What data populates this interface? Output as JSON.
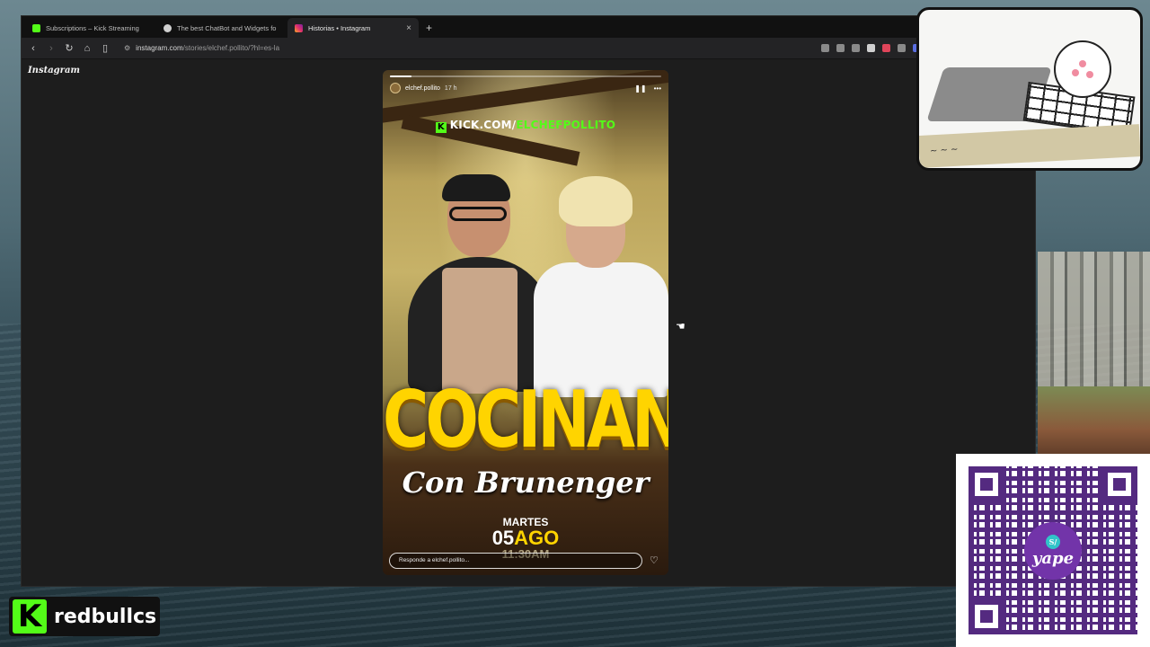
{
  "browser": {
    "tabs": [
      {
        "title": "Subscriptions – Kick Streaming",
        "favicon_color": "#53fc18",
        "active": false
      },
      {
        "title": "The best ChatBot and Widgets fo",
        "favicon_color": "#d0d0d0",
        "active": false
      },
      {
        "title": "Historias • Instagram",
        "favicon_color": "#e1306c",
        "active": true
      }
    ],
    "new_tab": "+",
    "tab_close": "×",
    "url_host": "instagram.com",
    "url_path": "/stories/elchef.pollito/?hl=es-la"
  },
  "instagram": {
    "logo": "Instagram",
    "story": {
      "username": "elchef.pollito",
      "time_ago": "17 h",
      "progress": 0.08,
      "kick_url_prefix": "KICK.COM/",
      "kick_url_channel": "ELCHEFPOLLITO",
      "headline": "COCINANDO",
      "subhead": "Con Brunenger",
      "day": "MARTES",
      "date_num": "05",
      "date_month": "AGO",
      "time": "11:30AM",
      "reply_placeholder": "Responde a elchef.pollito..."
    }
  },
  "overlay": {
    "channel_name": "redbullcs",
    "qr_brand": "yape",
    "qr_symbol": "S/"
  },
  "colors": {
    "kick_green": "#53fc18",
    "yape_purple": "#6b2aa5",
    "headline_yellow": "#ffd400"
  }
}
